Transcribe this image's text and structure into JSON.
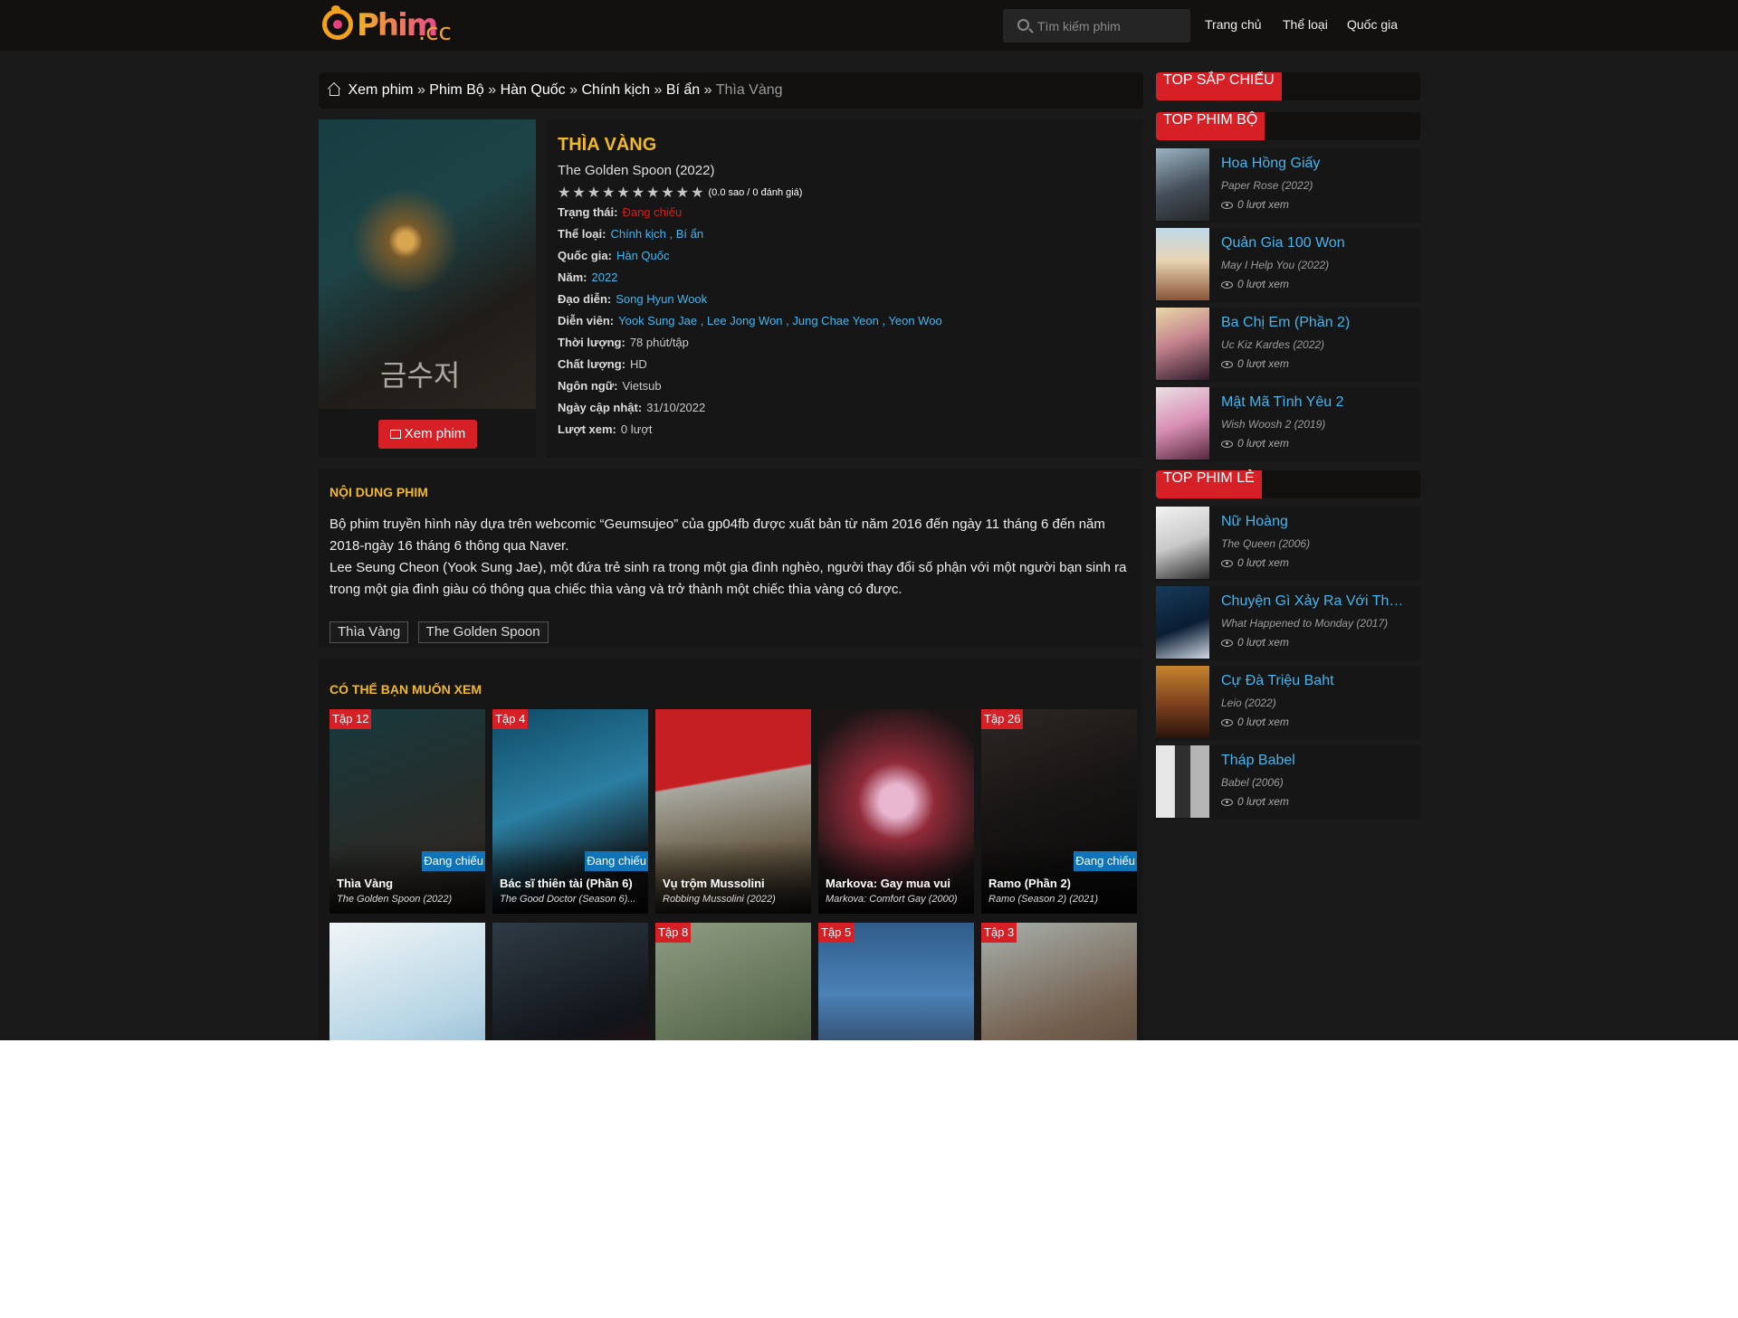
{
  "header": {
    "logo_text": "Phim",
    "logo_tld": ".cc",
    "search_placeholder": "Tìm kiếm phim",
    "nav": [
      "Trang chủ",
      "Thể loại",
      "Quốc gia"
    ]
  },
  "breadcrumb": {
    "items": [
      "Xem phim",
      "Phim Bộ",
      "Hàn Quốc",
      "Chính kịch",
      "Bí ẩn"
    ],
    "separator": "»",
    "current": "Thìa Vàng"
  },
  "movie": {
    "title_vi": "THÌA VÀNG",
    "title_en": "The Golden Spoon (2022)",
    "poster_text": "금수저",
    "stars": "★★★★★★★★★★",
    "rating_text": "(0.0 sao / 0 đánh giá)",
    "rating_value": 0,
    "info": [
      {
        "label": "Trạng thái:",
        "value": "Đang chiếu",
        "style": "red"
      },
      {
        "label": "Thể loại:",
        "value": "Chính kịch , Bí ẩn",
        "style": "blue"
      },
      {
        "label": "Quốc gia:",
        "value": "Hàn Quốc",
        "style": "blue"
      },
      {
        "label": "Năm:",
        "value": "2022",
        "style": "blue"
      },
      {
        "label": "Đạo diễn:",
        "value": "Song Hyun Wook",
        "style": "blue"
      },
      {
        "label": "Diễn viên:",
        "value": "Yook Sung Jae , Lee Jong Won , Jung Chae Yeon , Yeon Woo",
        "style": "blue"
      },
      {
        "label": "Thời lượng:",
        "value": "78 phút/tập",
        "style": "grey"
      },
      {
        "label": "Chất lượng:",
        "value": "HD",
        "style": "grey"
      },
      {
        "label": "Ngôn ngữ:",
        "value": "Vietsub",
        "style": "grey"
      },
      {
        "label": "Ngày cập nhật:",
        "value": "31/10/2022",
        "style": "grey"
      },
      {
        "label": "Lượt xem:",
        "value": "0 lượt",
        "style": "grey"
      }
    ],
    "watch_button": "Xem phim"
  },
  "content": {
    "title": "NỘI DUNG PHIM",
    "description": "Bộ phim truyền hình này dựa trên webcomic “Geumsujeo” của gp04fb được xuất bản từ năm 2016 đến ngày 11 tháng 6 đến năm 2018-ngày 16 tháng 6 thông qua Naver.",
    "description2": "Lee Seung Cheon (Yook Sung Jae), một đứa trẻ sinh ra trong một gia đình nghèo, người thay đổi số phận với một người bạn sinh ra trong một gia đình giàu có thông qua chiếc thìa vàng và trở thành một chiếc thìa vàng có được.",
    "tags": [
      "Thìa Vàng",
      "The Golden Spoon"
    ]
  },
  "related": {
    "title": "CÓ THỂ BẠN MUỐN XEM",
    "items": [
      {
        "episode": "Tập 12",
        "status": "Đang chiếu",
        "title": "Thìa Vàng",
        "subtitle": "The Golden Spoon (2022)",
        "bg": "linear-gradient(160deg,#17383c,#2c2a26 70%,#1b1915)"
      },
      {
        "episode": "Tập 4",
        "status": "Đang chiếu",
        "title": "Bác sĩ thiên tài (Phần 6)",
        "subtitle": "The Good Doctor (Season 6)...",
        "bg": "linear-gradient(160deg,#0f4b66,#2b7ea2 45%,#101010 80%)"
      },
      {
        "episode": "",
        "status": "",
        "title": "Vụ trộm Mussolini",
        "subtitle": "Robbing Mussolini (2022)",
        "bg": "linear-gradient(170deg,#c61f23 0 35%,#a8a8a0 36%,#675b45 70%,#23201c)"
      },
      {
        "episode": "",
        "status": "",
        "title": "Markova: Gay mua vui",
        "subtitle": "Markova: Comfort Gay (2000)",
        "bg": "radial-gradient(circle at 50% 45%,#e8b6cf 0 12%,#8f2a39 28%,#1b1515 72%)"
      },
      {
        "episode": "Tập 26",
        "status": "Đang chiếu",
        "title": "Ramo (Phần 2)",
        "subtitle": "Ramo (Season 2) (2021)",
        "bg": "linear-gradient(160deg,#2c2724,#171514 45%,#080808)"
      },
      {
        "episode": "",
        "status": "",
        "title": "",
        "subtitle": "",
        "bg": "linear-gradient(160deg,#f1f5f7,#b8d6e5 50%,#6ea0bf)"
      },
      {
        "episode": "",
        "status": "",
        "title": "",
        "subtitle": "",
        "bg": "linear-gradient(160deg,#2f3b45,#111419 55%,#5a0d0d)"
      },
      {
        "episode": "Tập 8",
        "status": "",
        "title": "",
        "subtitle": "",
        "bg": "linear-gradient(160deg,#8f9c83,#5a6b4f 55%,#2f332d)"
      },
      {
        "episode": "Tập 5",
        "status": "",
        "title": "",
        "subtitle": "",
        "bg": "linear-gradient(180deg,#2f5c8a,#4b81b7 35%,#263245 75%)"
      },
      {
        "episode": "Tập 3",
        "status": "",
        "title": "",
        "subtitle": "",
        "bg": "linear-gradient(160deg,#a7b0ac,#74604f 50%,#433326)"
      }
    ]
  },
  "sidebar": {
    "coming": {
      "title": "TOP SẮP CHIẾU"
    },
    "series": {
      "title": "TOP PHIM BỘ",
      "items": [
        {
          "title": "Hoa Hồng Giấy",
          "subtitle": "Paper Rose (2022)",
          "views": "0 lượt xem",
          "bg": "linear-gradient(160deg,#9bb5c3,#434d58 55%,#252627)"
        },
        {
          "title": "Quản Gia 100 Won",
          "subtitle": "May I Help You (2022)",
          "views": "0 lượt xem",
          "bg": "linear-gradient(180deg,#bfd9ea,#e8d4b2 45%,#8b5538)"
        },
        {
          "title": "Ba Chị Em (Phần 2)",
          "subtitle": "Uc Kiz Kardes (2022)",
          "views": "0 lượt xem",
          "bg": "linear-gradient(160deg,#e9d8a6,#c5848f 45%,#321b2a)"
        },
        {
          "title": "Mật Mã Tình Yêu 2",
          "subtitle": "Wish Woosh 2 (2019)",
          "views": "0 lượt xem",
          "bg": "linear-gradient(160deg,#eae0e4,#d98fb4 50%,#58293e)"
        }
      ]
    },
    "movies": {
      "title": "TOP PHIM LẺ",
      "items": [
        {
          "title": "Nữ Hoàng",
          "subtitle": "The Queen (2006)",
          "views": "0 lượt xem",
          "bg": "linear-gradient(160deg,#f3f3f3,#c9c9c9 50%,#2d2d2d)"
        },
        {
          "title": "Chuyện Gì Xảy Ra Với Thứ Hai",
          "subtitle": "What Happened to Monday (2017)",
          "views": "0 lượt xem",
          "bg": "linear-gradient(160deg,#173b59,#0a1d33 55%,#d0d8e4)"
        },
        {
          "title": "Cự Đà Triệu Baht",
          "subtitle": "Leio (2022)",
          "views": "0 lượt xem",
          "bg": "linear-gradient(180deg,#c5832c,#7b3f1e 55%,#29140c)"
        },
        {
          "title": "Tháp Babel",
          "subtitle": "Babel (2006)",
          "views": "0 lượt xem",
          "bg": "linear-gradient(90deg,#e6e6e6 0 35%,#2f2f2f 36% 64%,#b5b5b5 65%)"
        }
      ]
    }
  }
}
